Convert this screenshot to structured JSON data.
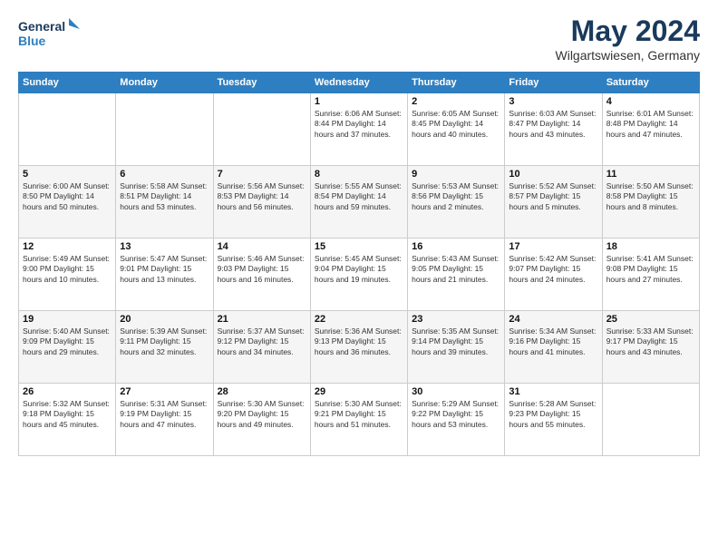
{
  "logo": {
    "line1": "General",
    "line2": "Blue"
  },
  "title": "May 2024",
  "subtitle": "Wilgartswiesen, Germany",
  "days_of_week": [
    "Sunday",
    "Monday",
    "Tuesday",
    "Wednesday",
    "Thursday",
    "Friday",
    "Saturday"
  ],
  "weeks": [
    [
      {
        "day": "",
        "info": ""
      },
      {
        "day": "",
        "info": ""
      },
      {
        "day": "",
        "info": ""
      },
      {
        "day": "1",
        "info": "Sunrise: 6:06 AM\nSunset: 8:44 PM\nDaylight: 14 hours\nand 37 minutes."
      },
      {
        "day": "2",
        "info": "Sunrise: 6:05 AM\nSunset: 8:45 PM\nDaylight: 14 hours\nand 40 minutes."
      },
      {
        "day": "3",
        "info": "Sunrise: 6:03 AM\nSunset: 8:47 PM\nDaylight: 14 hours\nand 43 minutes."
      },
      {
        "day": "4",
        "info": "Sunrise: 6:01 AM\nSunset: 8:48 PM\nDaylight: 14 hours\nand 47 minutes."
      }
    ],
    [
      {
        "day": "5",
        "info": "Sunrise: 6:00 AM\nSunset: 8:50 PM\nDaylight: 14 hours\nand 50 minutes."
      },
      {
        "day": "6",
        "info": "Sunrise: 5:58 AM\nSunset: 8:51 PM\nDaylight: 14 hours\nand 53 minutes."
      },
      {
        "day": "7",
        "info": "Sunrise: 5:56 AM\nSunset: 8:53 PM\nDaylight: 14 hours\nand 56 minutes."
      },
      {
        "day": "8",
        "info": "Sunrise: 5:55 AM\nSunset: 8:54 PM\nDaylight: 14 hours\nand 59 minutes."
      },
      {
        "day": "9",
        "info": "Sunrise: 5:53 AM\nSunset: 8:56 PM\nDaylight: 15 hours\nand 2 minutes."
      },
      {
        "day": "10",
        "info": "Sunrise: 5:52 AM\nSunset: 8:57 PM\nDaylight: 15 hours\nand 5 minutes."
      },
      {
        "day": "11",
        "info": "Sunrise: 5:50 AM\nSunset: 8:58 PM\nDaylight: 15 hours\nand 8 minutes."
      }
    ],
    [
      {
        "day": "12",
        "info": "Sunrise: 5:49 AM\nSunset: 9:00 PM\nDaylight: 15 hours\nand 10 minutes."
      },
      {
        "day": "13",
        "info": "Sunrise: 5:47 AM\nSunset: 9:01 PM\nDaylight: 15 hours\nand 13 minutes."
      },
      {
        "day": "14",
        "info": "Sunrise: 5:46 AM\nSunset: 9:03 PM\nDaylight: 15 hours\nand 16 minutes."
      },
      {
        "day": "15",
        "info": "Sunrise: 5:45 AM\nSunset: 9:04 PM\nDaylight: 15 hours\nand 19 minutes."
      },
      {
        "day": "16",
        "info": "Sunrise: 5:43 AM\nSunset: 9:05 PM\nDaylight: 15 hours\nand 21 minutes."
      },
      {
        "day": "17",
        "info": "Sunrise: 5:42 AM\nSunset: 9:07 PM\nDaylight: 15 hours\nand 24 minutes."
      },
      {
        "day": "18",
        "info": "Sunrise: 5:41 AM\nSunset: 9:08 PM\nDaylight: 15 hours\nand 27 minutes."
      }
    ],
    [
      {
        "day": "19",
        "info": "Sunrise: 5:40 AM\nSunset: 9:09 PM\nDaylight: 15 hours\nand 29 minutes."
      },
      {
        "day": "20",
        "info": "Sunrise: 5:39 AM\nSunset: 9:11 PM\nDaylight: 15 hours\nand 32 minutes."
      },
      {
        "day": "21",
        "info": "Sunrise: 5:37 AM\nSunset: 9:12 PM\nDaylight: 15 hours\nand 34 minutes."
      },
      {
        "day": "22",
        "info": "Sunrise: 5:36 AM\nSunset: 9:13 PM\nDaylight: 15 hours\nand 36 minutes."
      },
      {
        "day": "23",
        "info": "Sunrise: 5:35 AM\nSunset: 9:14 PM\nDaylight: 15 hours\nand 39 minutes."
      },
      {
        "day": "24",
        "info": "Sunrise: 5:34 AM\nSunset: 9:16 PM\nDaylight: 15 hours\nand 41 minutes."
      },
      {
        "day": "25",
        "info": "Sunrise: 5:33 AM\nSunset: 9:17 PM\nDaylight: 15 hours\nand 43 minutes."
      }
    ],
    [
      {
        "day": "26",
        "info": "Sunrise: 5:32 AM\nSunset: 9:18 PM\nDaylight: 15 hours\nand 45 minutes."
      },
      {
        "day": "27",
        "info": "Sunrise: 5:31 AM\nSunset: 9:19 PM\nDaylight: 15 hours\nand 47 minutes."
      },
      {
        "day": "28",
        "info": "Sunrise: 5:30 AM\nSunset: 9:20 PM\nDaylight: 15 hours\nand 49 minutes."
      },
      {
        "day": "29",
        "info": "Sunrise: 5:30 AM\nSunset: 9:21 PM\nDaylight: 15 hours\nand 51 minutes."
      },
      {
        "day": "30",
        "info": "Sunrise: 5:29 AM\nSunset: 9:22 PM\nDaylight: 15 hours\nand 53 minutes."
      },
      {
        "day": "31",
        "info": "Sunrise: 5:28 AM\nSunset: 9:23 PM\nDaylight: 15 hours\nand 55 minutes."
      },
      {
        "day": "",
        "info": ""
      }
    ]
  ]
}
